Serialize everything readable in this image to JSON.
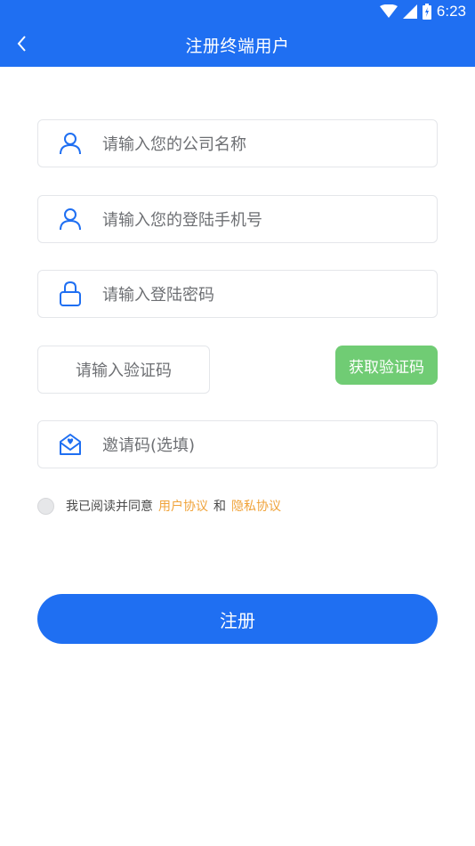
{
  "status_bar": {
    "time": "6:23",
    "icons": [
      "wifi-icon",
      "cell-signal-icon",
      "battery-icon"
    ]
  },
  "app_bar": {
    "title": "注册终端用户",
    "back_icon": "chevron-left-icon"
  },
  "form": {
    "company_name": {
      "placeholder": "请输入您的公司名称",
      "icon": "user-icon"
    },
    "phone": {
      "placeholder": "请输入您的登陆手机号",
      "icon": "user-icon"
    },
    "password": {
      "placeholder": "请输入登陆密码",
      "icon": "lock-icon"
    },
    "verify_code": {
      "placeholder": "请输入验证码"
    },
    "get_code_label": "获取验证码",
    "invite_code": {
      "placeholder": "邀请码(选填)",
      "icon": "mail-heart-icon"
    }
  },
  "agreement": {
    "prefix": "我已阅读并同意",
    "user_agreement": "用户协议",
    "and": "和",
    "privacy_agreement": "隐私协议",
    "checked": false
  },
  "register_label": "注册",
  "colors": {
    "primary": "#1f6ff2",
    "green": "#70cc74",
    "link": "#f0a33a"
  }
}
